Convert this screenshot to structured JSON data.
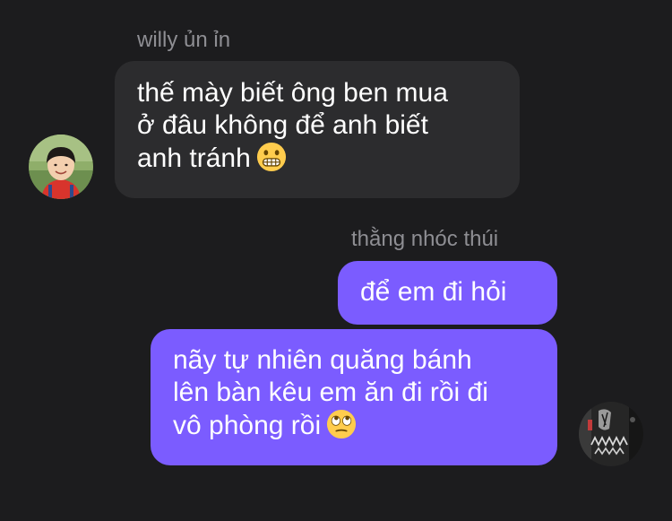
{
  "conversation": {
    "messages": [
      {
        "sender": "willy ủn ỉn",
        "lines": [
          "thế mày biết ông ben mua",
          "ở đâu không để anh biết",
          "anh tránh"
        ],
        "emoji": "grimacing-face-emoji"
      },
      {
        "sender": "thằng nhóc thúi",
        "lines": [
          "để em đi hỏi"
        ]
      },
      {
        "lines": [
          "nãy tự nhiên quăng bánh",
          "lên bàn kêu em ăn đi rồi đi",
          "vô phòng rồi"
        ],
        "emoji": "rolling-eyes-face-emoji"
      }
    ]
  },
  "colors": {
    "background": "#1c1c1e",
    "incoming_bubble": "#2c2c2e",
    "outgoing_bubble": "#7b5cff",
    "sender_name": "#8e8e93",
    "text": "#ffffff"
  }
}
